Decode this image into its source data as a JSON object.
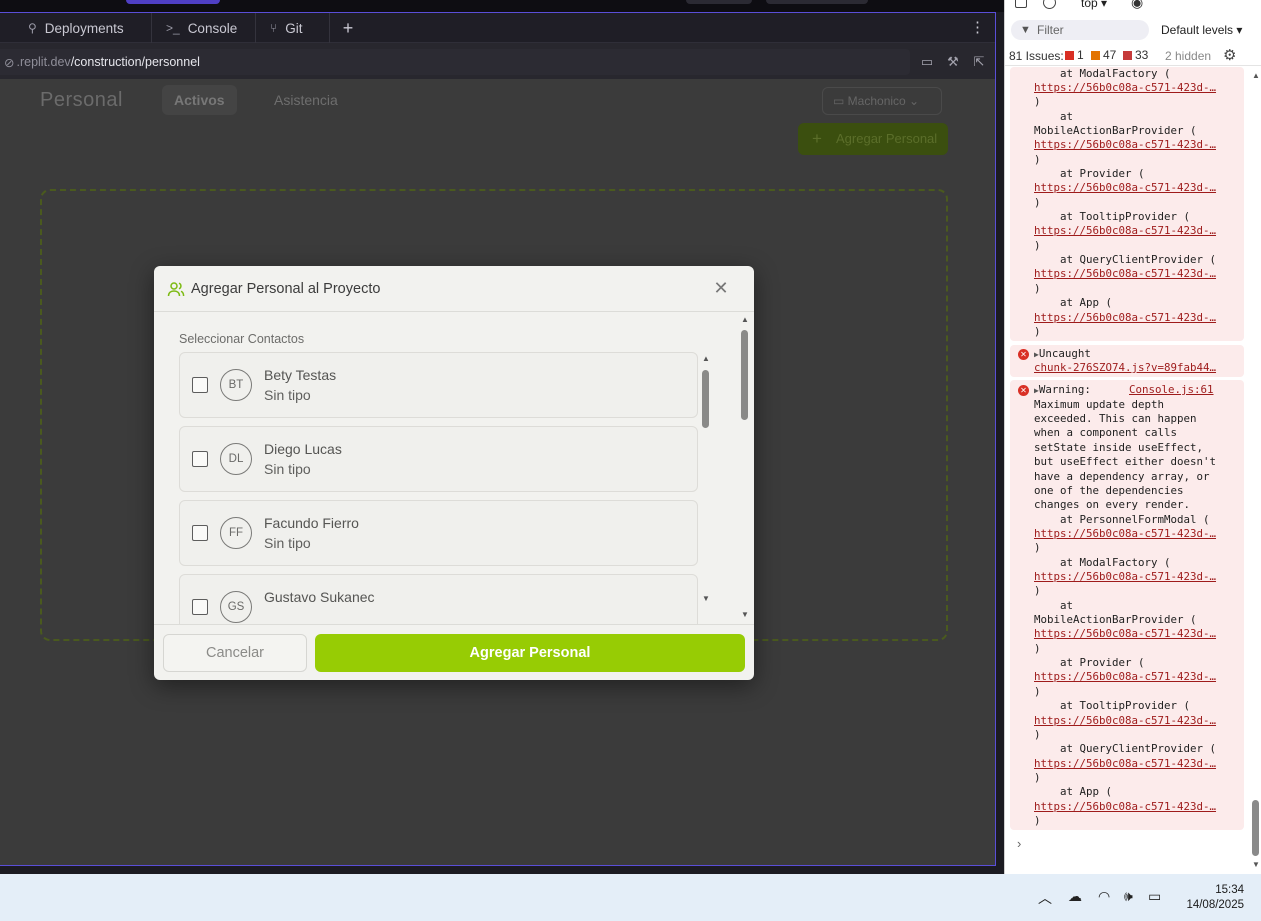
{
  "replit": {
    "tabs": [
      {
        "label": "Deployments",
        "icon": "deployments-icon"
      },
      {
        "label": "Console",
        "icon": "console-prompt-icon"
      },
      {
        "label": "Git",
        "icon": "git-branch-icon"
      }
    ],
    "url": {
      "domain": ".replit.dev",
      "path": "/construction/personnel"
    }
  },
  "app": {
    "title": "Personal",
    "tabs": {
      "active": "Activos",
      "other": "Asistencia"
    },
    "project_select": "Machonico",
    "add_button": "Agregar Personal"
  },
  "modal": {
    "title": "Agregar Personal al Proyecto",
    "section_label": "Seleccionar Contactos",
    "contacts": [
      {
        "initials": "BT",
        "name": "Bety Testas",
        "type": "Sin tipo"
      },
      {
        "initials": "DL",
        "name": "Diego Lucas",
        "type": "Sin tipo"
      },
      {
        "initials": "FF",
        "name": "Facundo Fierro",
        "type": "Sin tipo"
      },
      {
        "initials": "GS",
        "name": "Gustavo Sukanec",
        "type": ""
      }
    ],
    "cancel_label": "Cancelar",
    "submit_label": "Agregar Personal",
    "accent_color": "#97cc04"
  },
  "devtools": {
    "context": "top ▾",
    "filter_placeholder": "Filter",
    "levels": "Default levels ▾",
    "issues": {
      "label": "81 Issues:",
      "errors": "1",
      "warnings": "47",
      "info": "33",
      "hidden": "2 hidden"
    },
    "stack1": [
      "    at ModalFactory (",
      "https://56b0c08a-c571-423d-…",
      ")",
      "    at",
      "MobileActionBarProvider (",
      "https://56b0c08a-c571-423d-…",
      ")",
      "    at Provider (",
      "https://56b0c08a-c571-423d-…",
      ")",
      "    at TooltipProvider (",
      "https://56b0c08a-c571-423d-…",
      ")",
      "    at QueryClientProvider (",
      "https://56b0c08a-c571-423d-…",
      ")",
      "    at App (",
      "https://56b0c08a-c571-423d-…",
      ")"
    ],
    "uncaught": {
      "label": "Uncaught",
      "source": "chunk-276SZO74.js?v=89fab44…"
    },
    "warning": {
      "label": "Warning:",
      "source": "Console.js:61",
      "message": [
        "Maximum update depth",
        "exceeded. This can happen",
        "when a component calls",
        "setState inside useEffect,",
        "but useEffect either doesn't",
        "have a dependency array, or",
        "one of the dependencies",
        "changes on every render."
      ],
      "stack": [
        "    at PersonnelFormModal (",
        "https://56b0c08a-c571-423d-…",
        ")",
        "    at ModalFactory (",
        "https://56b0c08a-c571-423d-…",
        ")",
        "    at",
        "MobileActionBarProvider (",
        "https://56b0c08a-c571-423d-…",
        ")",
        "    at Provider (",
        "https://56b0c08a-c571-423d-…",
        ")",
        "    at TooltipProvider (",
        "https://56b0c08a-c571-423d-…",
        ")",
        "    at QueryClientProvider (",
        "https://56b0c08a-c571-423d-…",
        ")",
        "    at App (",
        "https://56b0c08a-c571-423d-…",
        ")"
      ]
    },
    "prompt": "›"
  },
  "taskbar": {
    "time": "15:34",
    "date": "14/08/2025"
  }
}
